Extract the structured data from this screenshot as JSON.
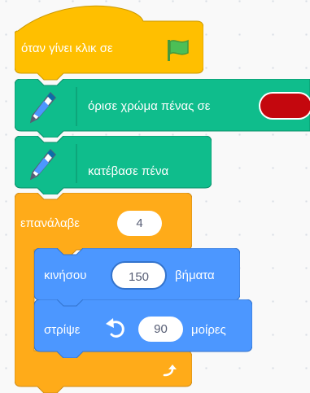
{
  "script": {
    "hat": {
      "label": "όταν γίνει κλικ σε",
      "icon": "green-flag-icon"
    },
    "set_pen_color": {
      "label": "όρισε χρώμα πένας σε",
      "icon": "pen-icon",
      "color_value": "#c4070e"
    },
    "pen_down": {
      "label": "κατέβασε πένα",
      "icon": "pen-icon"
    },
    "repeat": {
      "label": "επανάλαβε",
      "times": "4",
      "loop_icon": "loop-arrow-icon"
    },
    "move": {
      "label": "κινήσου",
      "steps": "150",
      "suffix": "βήματα"
    },
    "turn": {
      "label": "στρίψε",
      "icon": "rotate-left-icon",
      "degrees": "90",
      "suffix": "μοίρες"
    }
  },
  "colors": {
    "events": "#ffbf00",
    "pen": "#0fbd8c",
    "control": "#ffab19",
    "motion": "#4c97ff",
    "pen_color_value": "#c4070e"
  }
}
